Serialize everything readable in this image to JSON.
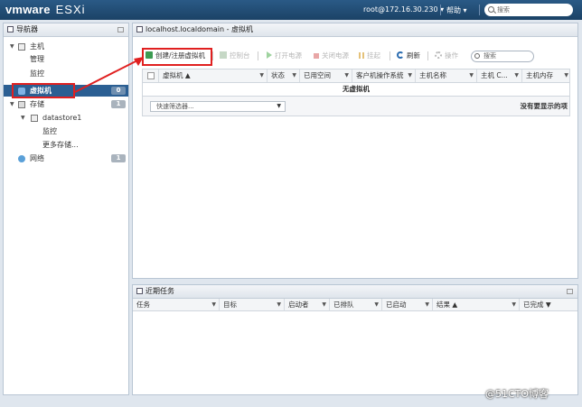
{
  "app": {
    "brand_main": "vmware",
    "brand_product": "ESXi"
  },
  "topbar": {
    "user": "root@172.16.30.230 ▾",
    "help": "帮助 ▾",
    "search_placeholder": "搜索"
  },
  "navigator": {
    "title": "导航器",
    "items": [
      {
        "label": "主机",
        "level": 0,
        "twisty": "▼",
        "icon": "host-icon"
      },
      {
        "label": "管理",
        "level": 1
      },
      {
        "label": "监控",
        "level": 1
      },
      {
        "label": "虚拟机",
        "level": 0,
        "count": "0",
        "selected": true,
        "icon": "vm-icon"
      },
      {
        "label": "存储",
        "level": 0,
        "count": "1",
        "twisty": "▼",
        "icon": "storage-icon"
      },
      {
        "label": "datastore1",
        "level": 1,
        "twisty": "▼",
        "icon": "datastore-icon"
      },
      {
        "label": "监控",
        "level": 2
      },
      {
        "label": "更多存储...",
        "level": 2
      },
      {
        "label": "网络",
        "level": 0,
        "count": "1",
        "icon": "network-icon"
      }
    ]
  },
  "main": {
    "title": "localhost.localdomain - 虚拟机",
    "toolbar": {
      "create": "创建/注册虚拟机",
      "console": "控制台",
      "power_on": "打开电源",
      "power_off": "关闭电源",
      "suspend": "挂起",
      "refresh": "刷新",
      "actions": "操作"
    },
    "search_placeholder": "搜索",
    "columns": [
      "虚拟机 ▲",
      "状态",
      "已用空间",
      "客户机操作系统",
      "主机名称",
      "主机 C...",
      "主机内存"
    ],
    "empty_text": "无虚拟机",
    "quick_filter": "快速筛选器...",
    "no_items": "没有要显示的项"
  },
  "tasks": {
    "title": "近期任务",
    "columns": [
      "任务",
      "目标",
      "启动者",
      "已排队",
      "已启动",
      "结果 ▲",
      "已完成 ▼"
    ]
  },
  "watermark": "@51CTO博客",
  "colors": {
    "topbar": "#1f4a74",
    "selected": "#2b5f93",
    "annotation": "#e02020"
  }
}
